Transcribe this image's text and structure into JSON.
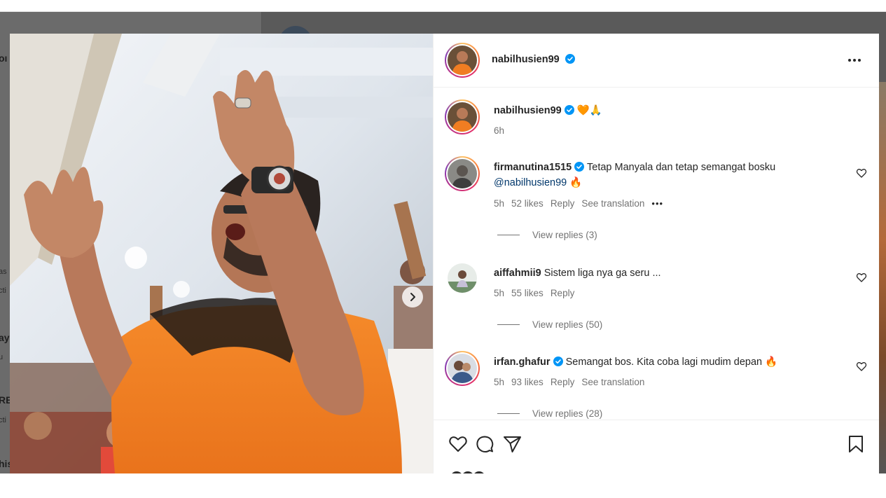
{
  "underlying_page": {
    "snippets": [
      {
        "text": "oı",
        "kind": "t"
      },
      {
        "text": "as",
        "kind": "s"
      },
      {
        "text": "cti",
        "kind": "s"
      },
      {
        "text": "ay",
        "kind": "t"
      },
      {
        "text": "u",
        "kind": "s"
      },
      {
        "text": "RE",
        "kind": "t"
      },
      {
        "text": "cti",
        "kind": "s"
      },
      {
        "text": "his",
        "kind": "t"
      }
    ]
  },
  "post": {
    "author": "nabilhusien99",
    "author_verified": true,
    "caption_emojis": "🧡🙏",
    "caption_time": "6h",
    "more_icon": "more-horizontal-icon"
  },
  "comments": [
    {
      "username": "firmanutina1515",
      "verified": true,
      "text": "Tetap Manyala dan tetap semangat bosku",
      "mention": "@nabilhusien99",
      "emoji": "🔥",
      "time": "5h",
      "likes": "52 likes",
      "reply": "Reply",
      "translation": "See translation",
      "more": "•••",
      "view_replies": "View replies (3)",
      "story_ring": true
    },
    {
      "username": "aiffahmii9",
      "verified": false,
      "text": "Sistem liga nya ga seru ...",
      "time": "5h",
      "likes": "55 likes",
      "reply": "Reply",
      "view_replies": "View replies (50)",
      "story_ring": false
    },
    {
      "username": "irfan.ghafur",
      "verified": true,
      "text": "Semangat bos. Kita coba lagi mudim depan",
      "emoji": "🔥",
      "time": "5h",
      "likes": "93 likes",
      "reply": "Reply",
      "translation": "See translation",
      "view_replies": "View replies (28)",
      "story_ring": true
    }
  ],
  "actions": {
    "like_icon": "heart-outline-icon",
    "comment_icon": "comment-bubble-icon",
    "share_icon": "paper-plane-icon",
    "save_icon": "bookmark-icon"
  },
  "colors": {
    "backdrop": "#5a5a5a",
    "verified_blue": "#0095f6",
    "mention": "#00376b",
    "shirt_orange": "#f07d22"
  }
}
